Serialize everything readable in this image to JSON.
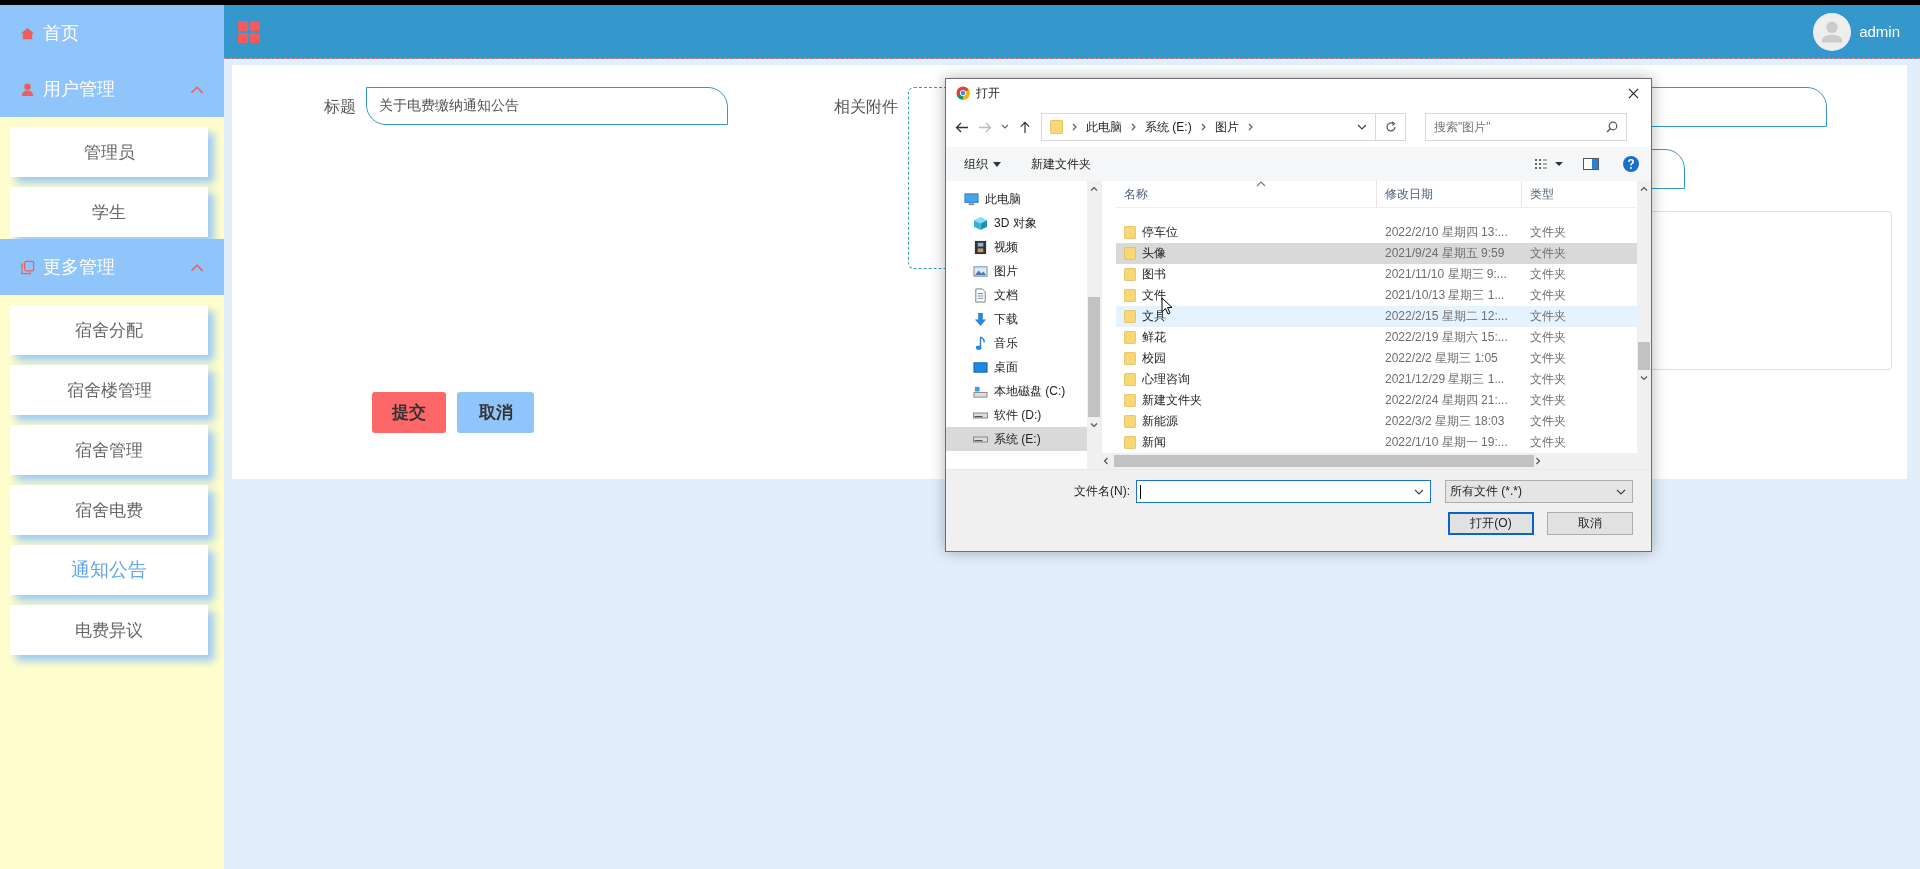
{
  "sidebar": {
    "items": [
      {
        "kind": "link",
        "label": "首页"
      },
      {
        "kind": "group",
        "label": "用户管理",
        "expanded": true,
        "children": [
          {
            "label": "管理员",
            "selected": false
          },
          {
            "label": "学生",
            "selected": false
          }
        ]
      },
      {
        "kind": "group",
        "label": "更多管理",
        "expanded": true,
        "children": [
          {
            "label": "宿舍分配",
            "selected": false
          },
          {
            "label": "宿舍楼管理",
            "selected": false
          },
          {
            "label": "宿舍管理",
            "selected": false
          },
          {
            "label": "宿舍电费",
            "selected": false
          },
          {
            "label": "通知公告",
            "selected": true
          },
          {
            "label": "电费异议",
            "selected": false
          }
        ]
      }
    ]
  },
  "topbar": {
    "user": "admin"
  },
  "form": {
    "title_label": "标题",
    "title_value": "关于电费缴纳通知公告",
    "attachment_label": "相关附件",
    "buttons": [
      {
        "label": "提交",
        "kind": "primary"
      },
      {
        "label": "取消",
        "kind": "secondary"
      }
    ]
  },
  "dialog": {
    "title": "打开",
    "path": [
      "此电脑",
      "系统 (E:)",
      "图片"
    ],
    "search": {
      "placeholder": "搜索\"图片\""
    },
    "toolbar": [
      "组织",
      "新建文件夹"
    ],
    "nav": [
      {
        "label": "此电脑",
        "kind": "pc",
        "selected": false,
        "children": [
          {
            "label": "3D 对象",
            "kind": "cube",
            "selected": false
          },
          {
            "label": "视频",
            "kind": "film",
            "selected": false
          },
          {
            "label": "图片",
            "kind": "image",
            "selected": false
          },
          {
            "label": "文档",
            "kind": "doc",
            "selected": false
          },
          {
            "label": "下载",
            "kind": "download",
            "selected": false
          },
          {
            "label": "音乐",
            "kind": "music",
            "selected": false
          },
          {
            "label": "桌面",
            "kind": "desktop",
            "selected": false
          },
          {
            "label": "本地磁盘 (C:)",
            "kind": "system-drive",
            "selected": false
          },
          {
            "label": "软件 (D:)",
            "kind": "drive",
            "selected": false
          },
          {
            "label": "系统 (E:)",
            "kind": "drive",
            "selected": true
          }
        ]
      }
    ],
    "columns": [
      "名称",
      "修改日期",
      "类型"
    ],
    "files": [
      {
        "name": "停车位",
        "modified": "2022/2/10 星期四 13:...",
        "type": "文件夹",
        "selected": false,
        "hovered": false
      },
      {
        "name": "头像",
        "modified": "2021/9/24 星期五 9:59",
        "type": "文件夹",
        "selected": true,
        "hovered": false
      },
      {
        "name": "图书",
        "modified": "2021/11/10 星期三 9:...",
        "type": "文件夹",
        "selected": false,
        "hovered": false
      },
      {
        "name": "文件",
        "modified": "2021/10/13 星期三 1...",
        "type": "文件夹",
        "selected": false,
        "hovered": false
      },
      {
        "name": "文具",
        "modified": "2022/2/15 星期二 12:...",
        "type": "文件夹",
        "selected": false,
        "hovered": true
      },
      {
        "name": "鲜花",
        "modified": "2022/2/19 星期六 15:...",
        "type": "文件夹",
        "selected": false,
        "hovered": false
      },
      {
        "name": "校园",
        "modified": "2022/2/2 星期三 1:05",
        "type": "文件夹",
        "selected": false,
        "hovered": false
      },
      {
        "name": "心理咨询",
        "modified": "2021/12/29 星期三 1...",
        "type": "文件夹",
        "selected": false,
        "hovered": false
      },
      {
        "name": "新建文件夹",
        "modified": "2022/2/24 星期四 21:...",
        "type": "文件夹",
        "selected": false,
        "hovered": false
      },
      {
        "name": "新能源",
        "modified": "2022/3/2 星期三 18:03",
        "type": "文件夹",
        "selected": false,
        "hovered": false
      },
      {
        "name": "新闻",
        "modified": "2022/1/10 星期一 19:...",
        "type": "文件夹",
        "selected": false,
        "hovered": false
      }
    ],
    "filename_label": "文件名(N):",
    "filetype": "所有文件 (*.*)",
    "buttons": [
      {
        "label": "打开(O)",
        "kind": "default"
      },
      {
        "label": "取消",
        "kind": "normal"
      }
    ]
  }
}
